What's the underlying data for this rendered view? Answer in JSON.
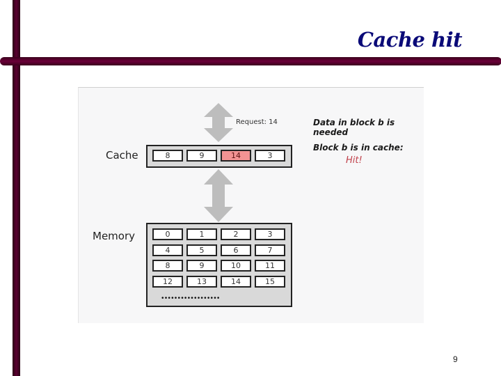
{
  "slide": {
    "title": "Cache hit",
    "page_number": "9"
  },
  "diagram": {
    "cache_label": "Cache",
    "memory_label": "Memory",
    "request_label": "Request: 14",
    "cache_blocks": [
      {
        "value": "8",
        "highlight": false
      },
      {
        "value": "9",
        "highlight": false
      },
      {
        "value": "14",
        "highlight": true
      },
      {
        "value": "3",
        "highlight": false
      }
    ],
    "memory_blocks": [
      [
        "0",
        "1",
        "2",
        "3"
      ],
      [
        "4",
        "5",
        "6",
        "7"
      ],
      [
        "8",
        "9",
        "10",
        "11"
      ],
      [
        "12",
        "13",
        "14",
        "15"
      ]
    ],
    "ellipsis": "••••••••••••••••••",
    "note_needed": "Data in block b is needed",
    "note_in_cache": "Block b is in cache:",
    "note_result": "Hit!",
    "colors": {
      "highlight": "#f29393",
      "hit_text": "#c0404a",
      "arrow": "#bdbdbd",
      "title": "#0a0a78"
    }
  }
}
